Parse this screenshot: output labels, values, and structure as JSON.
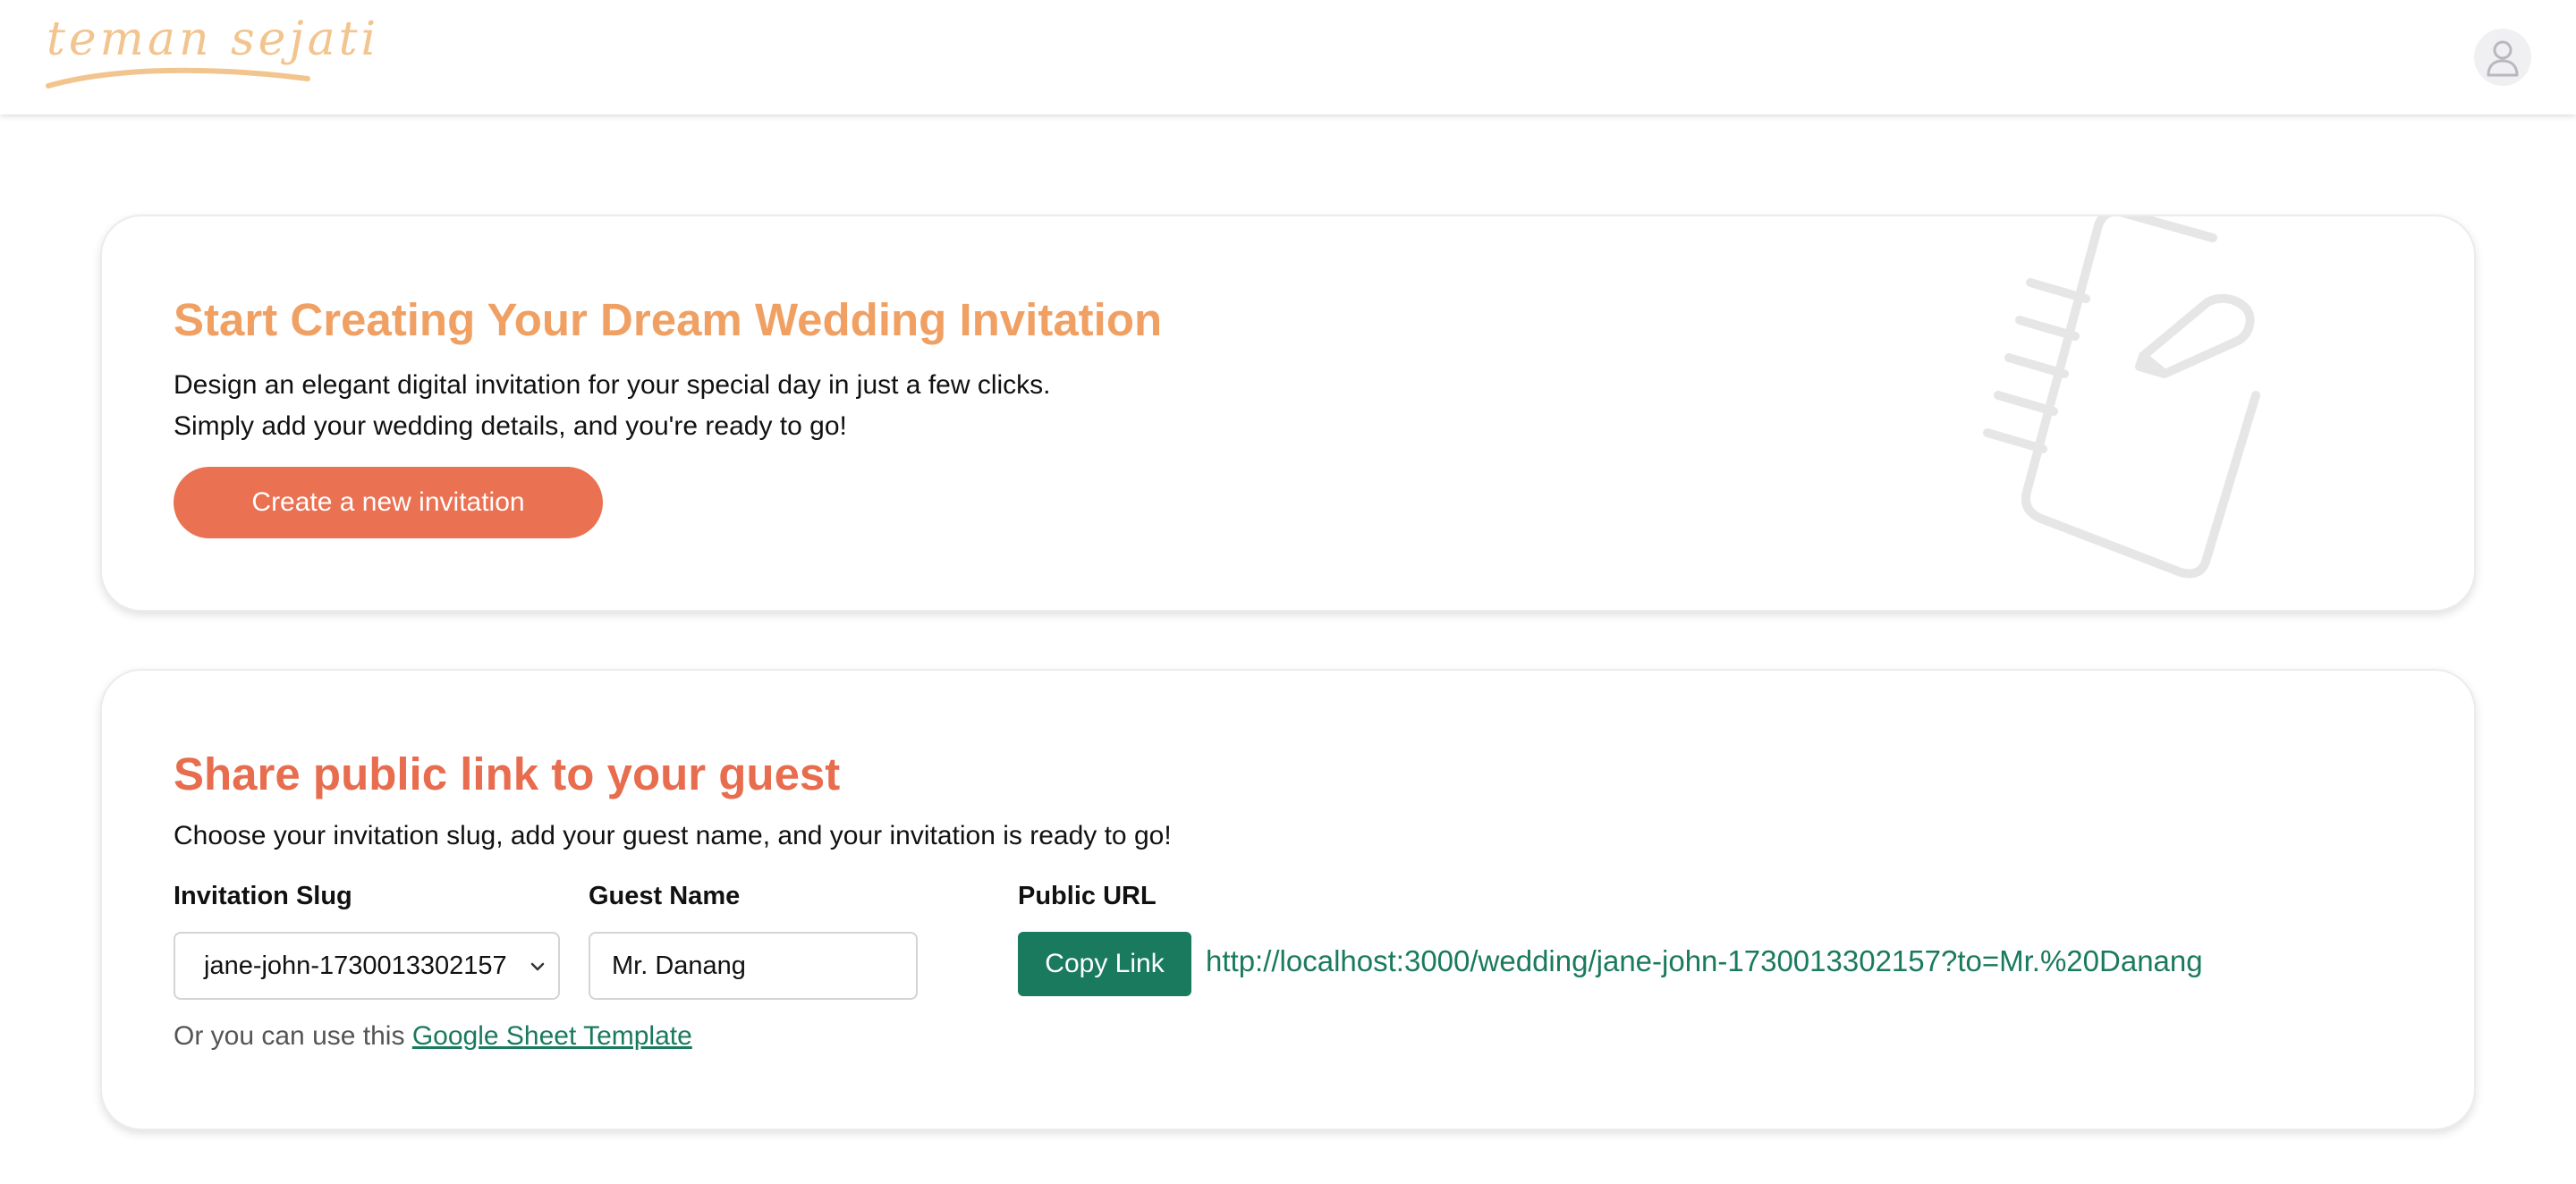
{
  "header": {
    "logo_text": "teman sejati",
    "avatar_icon": "user-icon"
  },
  "hero": {
    "title": "Start Creating Your Dream Wedding Invitation",
    "description_line1": "Design an elegant digital invitation for your special day in just a few clicks.",
    "description_line2": "Simply add your wedding details, and you're ready to go!",
    "create_button_label": "Create a new invitation",
    "illustration_icon": "notebook-pen-icon"
  },
  "share": {
    "title": "Share public link to your guest",
    "description": "Choose your invitation slug, add your guest name, and your invitation is ready to go!",
    "slug_label": "Invitation Slug",
    "slug_value": "jane-john-1730013302157",
    "guest_label": "Guest Name",
    "guest_value": "Mr. Danang",
    "public_url_label": "Public URL",
    "copy_button_label": "Copy Link",
    "public_url": "http://localhost:3000/wedding/jane-john-1730013302157?to=Mr.%20Danang",
    "sheet_note_prefix": "Or you can use this",
    "sheet_link_label": "Google Sheet Template"
  },
  "colors": {
    "logo": "#f2c48e",
    "hero_title": "#f0a062",
    "share_title": "#e86c4e",
    "primary_button": "#ea7152",
    "accent_green": "#1a7a5e",
    "illustration_stroke": "#e6e6e6"
  }
}
